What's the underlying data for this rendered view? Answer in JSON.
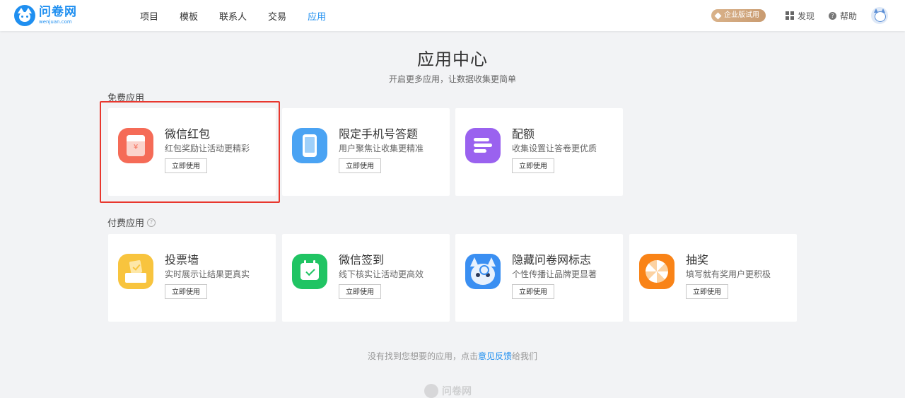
{
  "brand": {
    "name_cn": "问卷网",
    "name_en": "wenjuan.com",
    "icon": "fox-logo-icon"
  },
  "nav": {
    "items": [
      {
        "label": "项目",
        "active": false
      },
      {
        "label": "模板",
        "active": false
      },
      {
        "label": "联系人",
        "active": false
      },
      {
        "label": "交易",
        "active": false
      },
      {
        "label": "应用",
        "active": true
      }
    ],
    "active_color": "#1f8ff0"
  },
  "header_right": {
    "trial_badge": "企业版试用",
    "discover": "发现",
    "help": "帮助",
    "help_glyph": "?"
  },
  "page": {
    "title": "应用中心",
    "subtitle": "开启更多应用，让数据收集更简单"
  },
  "sections": {
    "free": {
      "label": "免费应用",
      "cards": [
        {
          "title": "微信红包",
          "desc": "红包奖励让活动更精彩",
          "button": "立即使用",
          "icon": "red-packet-icon",
          "icon_color": "#f56b57",
          "icon_glyph": "¥",
          "highlighted": true
        },
        {
          "title": "限定手机号答题",
          "desc": "用户聚焦让收集更精准",
          "button": "立即使用",
          "icon": "phone-icon",
          "icon_color": "#4aa3f3",
          "highlighted": false
        },
        {
          "title": "配额",
          "desc": "收集设置让答卷更优质",
          "button": "立即使用",
          "icon": "quota-icon",
          "icon_color": "#9a62ef",
          "highlighted": false
        }
      ]
    },
    "paid": {
      "label": "付费应用",
      "info_glyph": "?",
      "cards": [
        {
          "title": "投票墙",
          "desc": "实时展示让结果更真实",
          "button": "立即使用",
          "icon": "vote-box-icon",
          "icon_color": "#f8c43e"
        },
        {
          "title": "微信签到",
          "desc": "线下核实让活动更高效",
          "button": "立即使用",
          "icon": "calendar-check-icon",
          "icon_color": "#20c463"
        },
        {
          "title": "隐藏问卷网标志",
          "desc": "个性传播让品牌更显著",
          "button": "立即使用",
          "icon": "fox-mascot-icon",
          "icon_color": "#3a8ff2"
        },
        {
          "title": "抽奖",
          "desc": "填写就有奖用户更积极",
          "button": "立即使用",
          "icon": "prize-wheel-icon",
          "icon_color": "#f98317"
        }
      ]
    }
  },
  "footer": {
    "text_before": "没有找到您想要的应用，点击",
    "link": "意见反馈",
    "text_after": "给我们",
    "logo_text": "问卷网"
  },
  "colors": {
    "highlight_border": "#e8372e",
    "page_bg": "#f2f3f5"
  }
}
